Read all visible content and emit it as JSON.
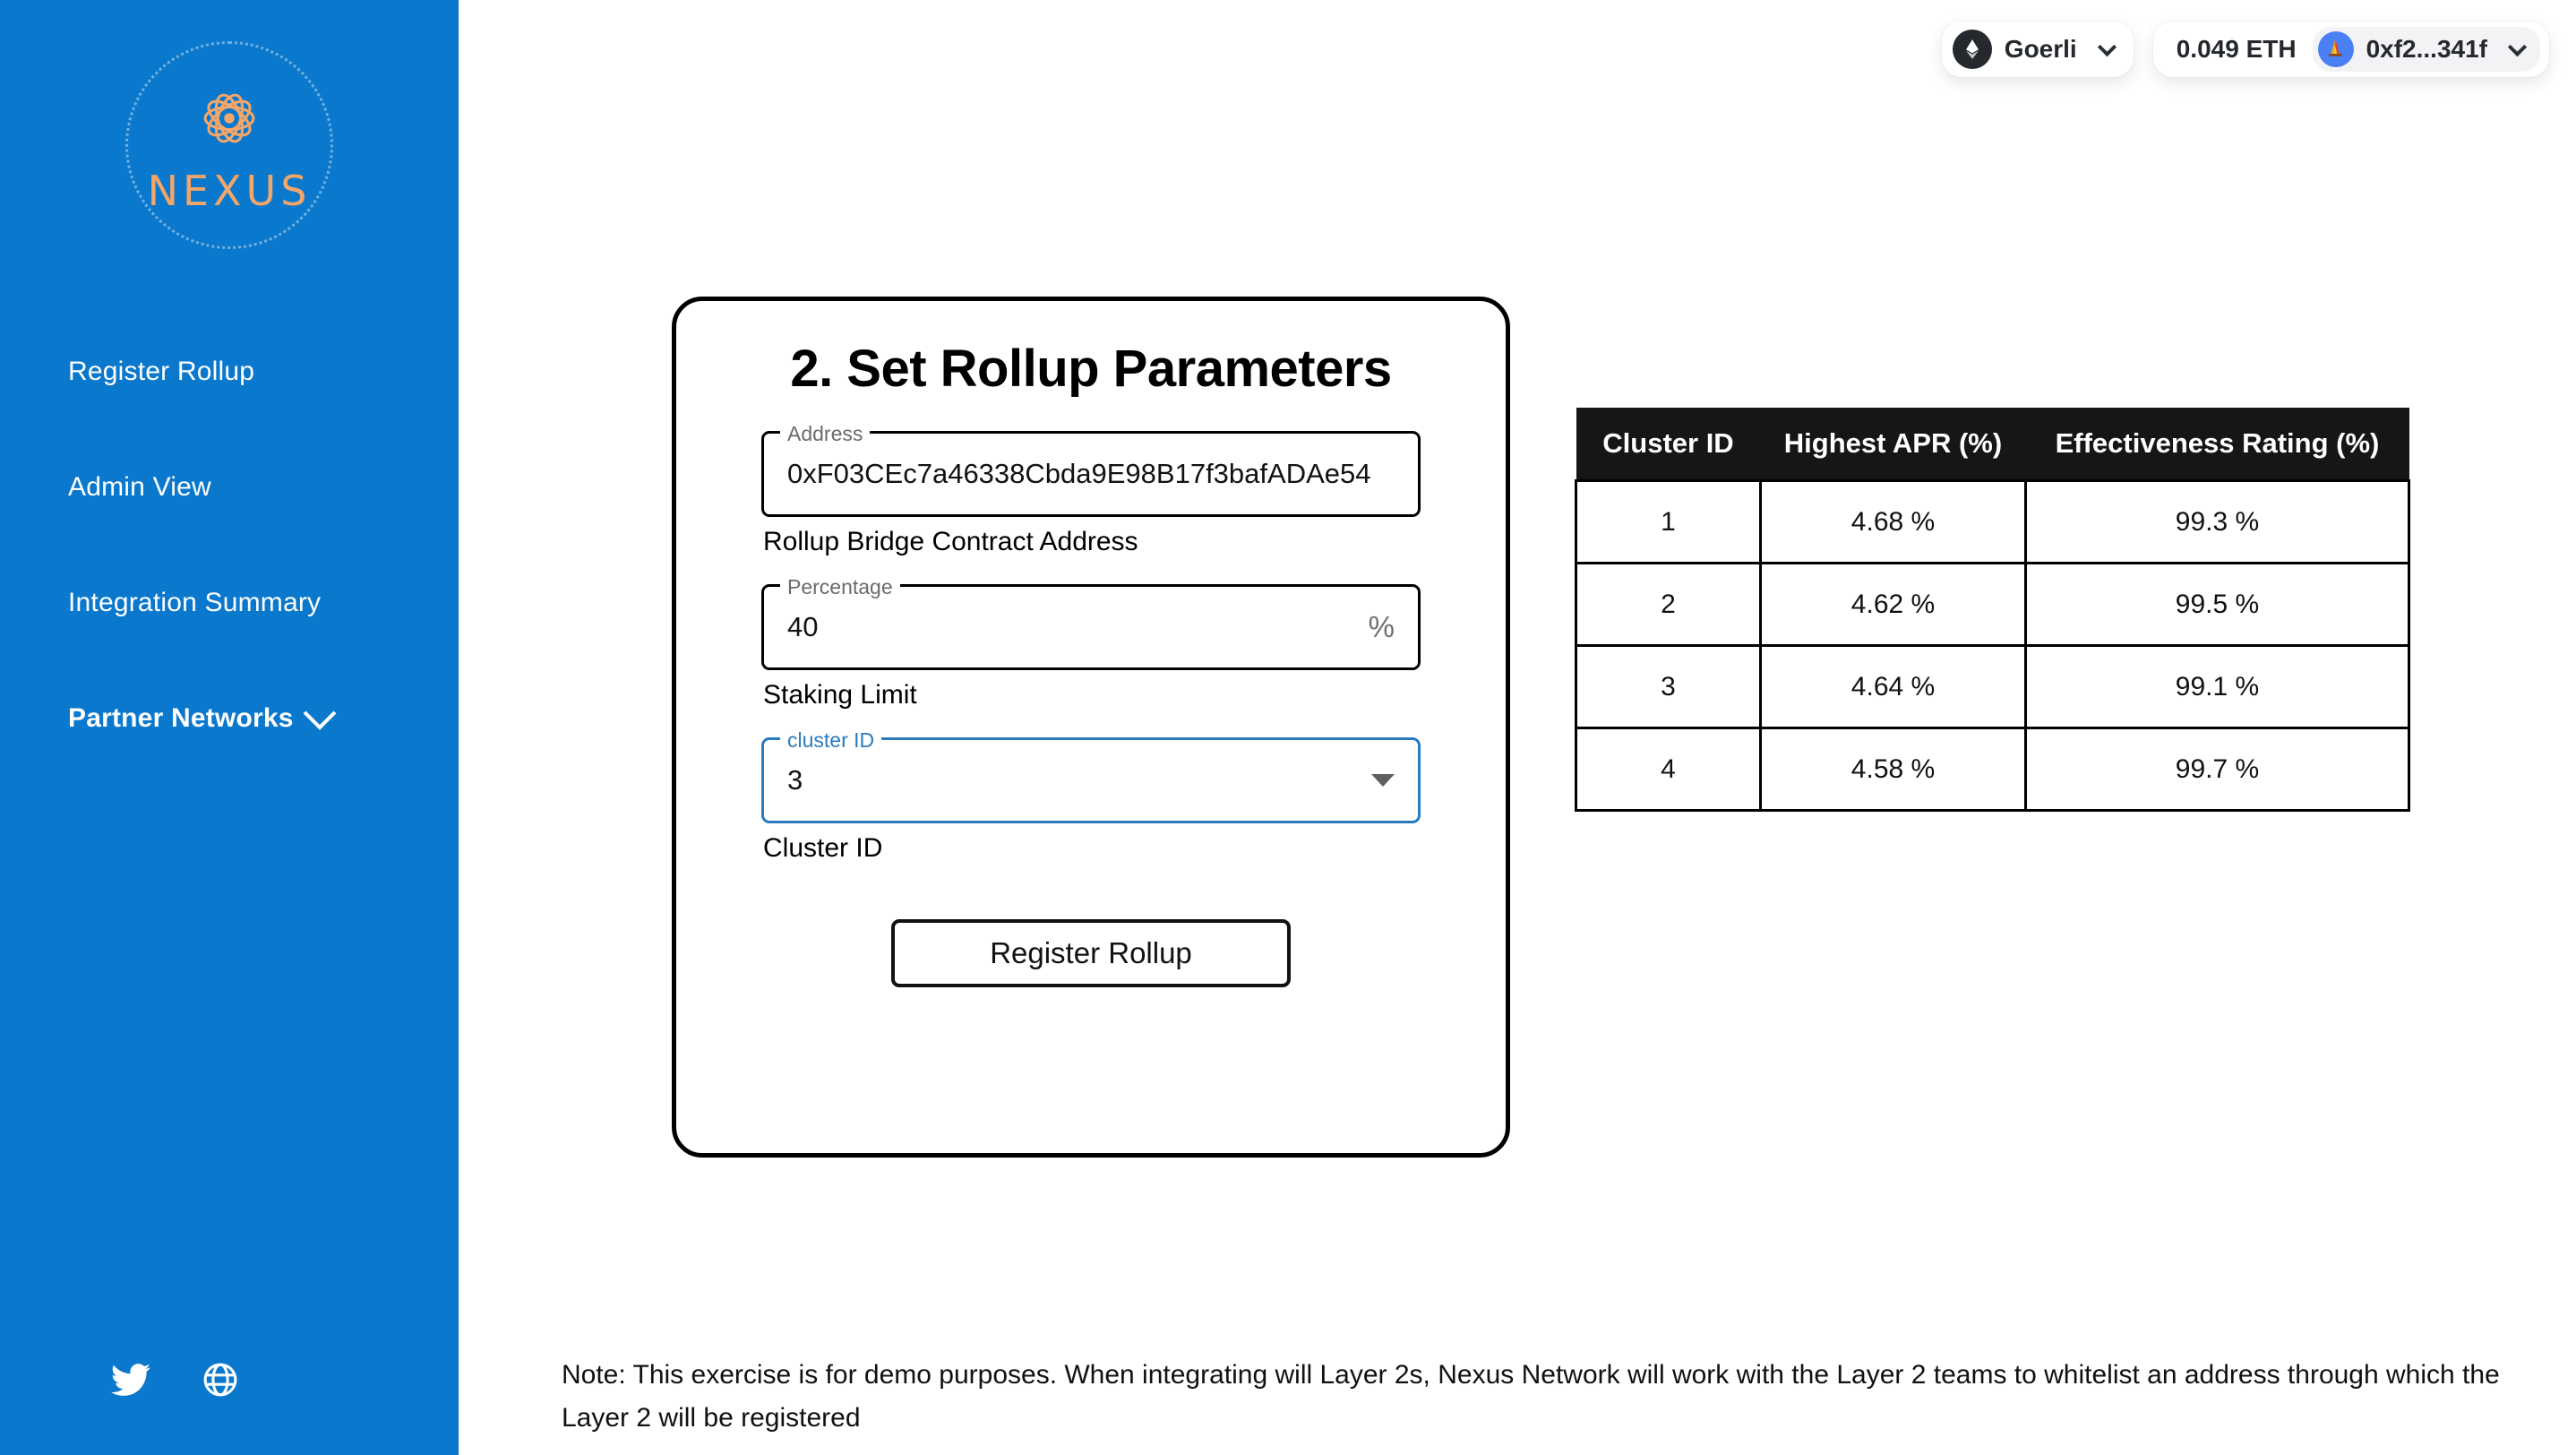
{
  "brand": {
    "logo_text": "NEXUS",
    "logo_icon": "atom-icon"
  },
  "sidebar": {
    "items": [
      {
        "label": "Register Rollup",
        "bold": false,
        "has_chevron": false
      },
      {
        "label": "Admin View",
        "bold": false,
        "has_chevron": false
      },
      {
        "label": "Integration Summary",
        "bold": false,
        "has_chevron": false
      },
      {
        "label": "Partner Networks",
        "bold": true,
        "has_chevron": true
      }
    ],
    "socials": [
      {
        "name": "twitter-icon"
      },
      {
        "name": "website-globe-icon"
      }
    ],
    "background_color": "#0a78cc"
  },
  "topbar": {
    "chain": {
      "name": "Goerli",
      "icon": "ethereum-icon"
    },
    "balance": "0.049 ETH",
    "account": {
      "address_short": "0xf2...341f",
      "avatar": "rainbow-wallet-avatar"
    }
  },
  "card": {
    "title": "2. Set Rollup Parameters",
    "fields": [
      {
        "legend": "Address",
        "value": "0xF03CEc7a46338Cbda9E98B17f3bafADAe54",
        "helper": "Rollup Bridge Contract Address",
        "adornment": "",
        "focused": false
      },
      {
        "legend": "Percentage",
        "value": "40",
        "helper": "Staking Limit",
        "adornment": "%",
        "focused": false
      },
      {
        "legend": "cluster ID",
        "value": "3",
        "helper": "Cluster ID",
        "adornment": "",
        "focused": true
      }
    ],
    "submit_label": "Register Rollup",
    "focus_color": "#2a7bbd"
  },
  "table": {
    "headers": [
      "Cluster ID",
      "Highest APR (%)",
      "Effectiveness Rating (%)"
    ],
    "rows": [
      [
        "1",
        "4.68 %",
        "99.3 %"
      ],
      [
        "2",
        "4.62 %",
        "99.5 %"
      ],
      [
        "3",
        "4.64 %",
        "99.1 %"
      ],
      [
        "4",
        "4.58 %",
        "99.7 %"
      ]
    ]
  },
  "note": {
    "text": "Note: This exercise is for demo purposes. When integrating will Layer 2s, Nexus Network will work with the Layer 2 teams to whitelist an address through which the Layer 2 will be registered"
  }
}
